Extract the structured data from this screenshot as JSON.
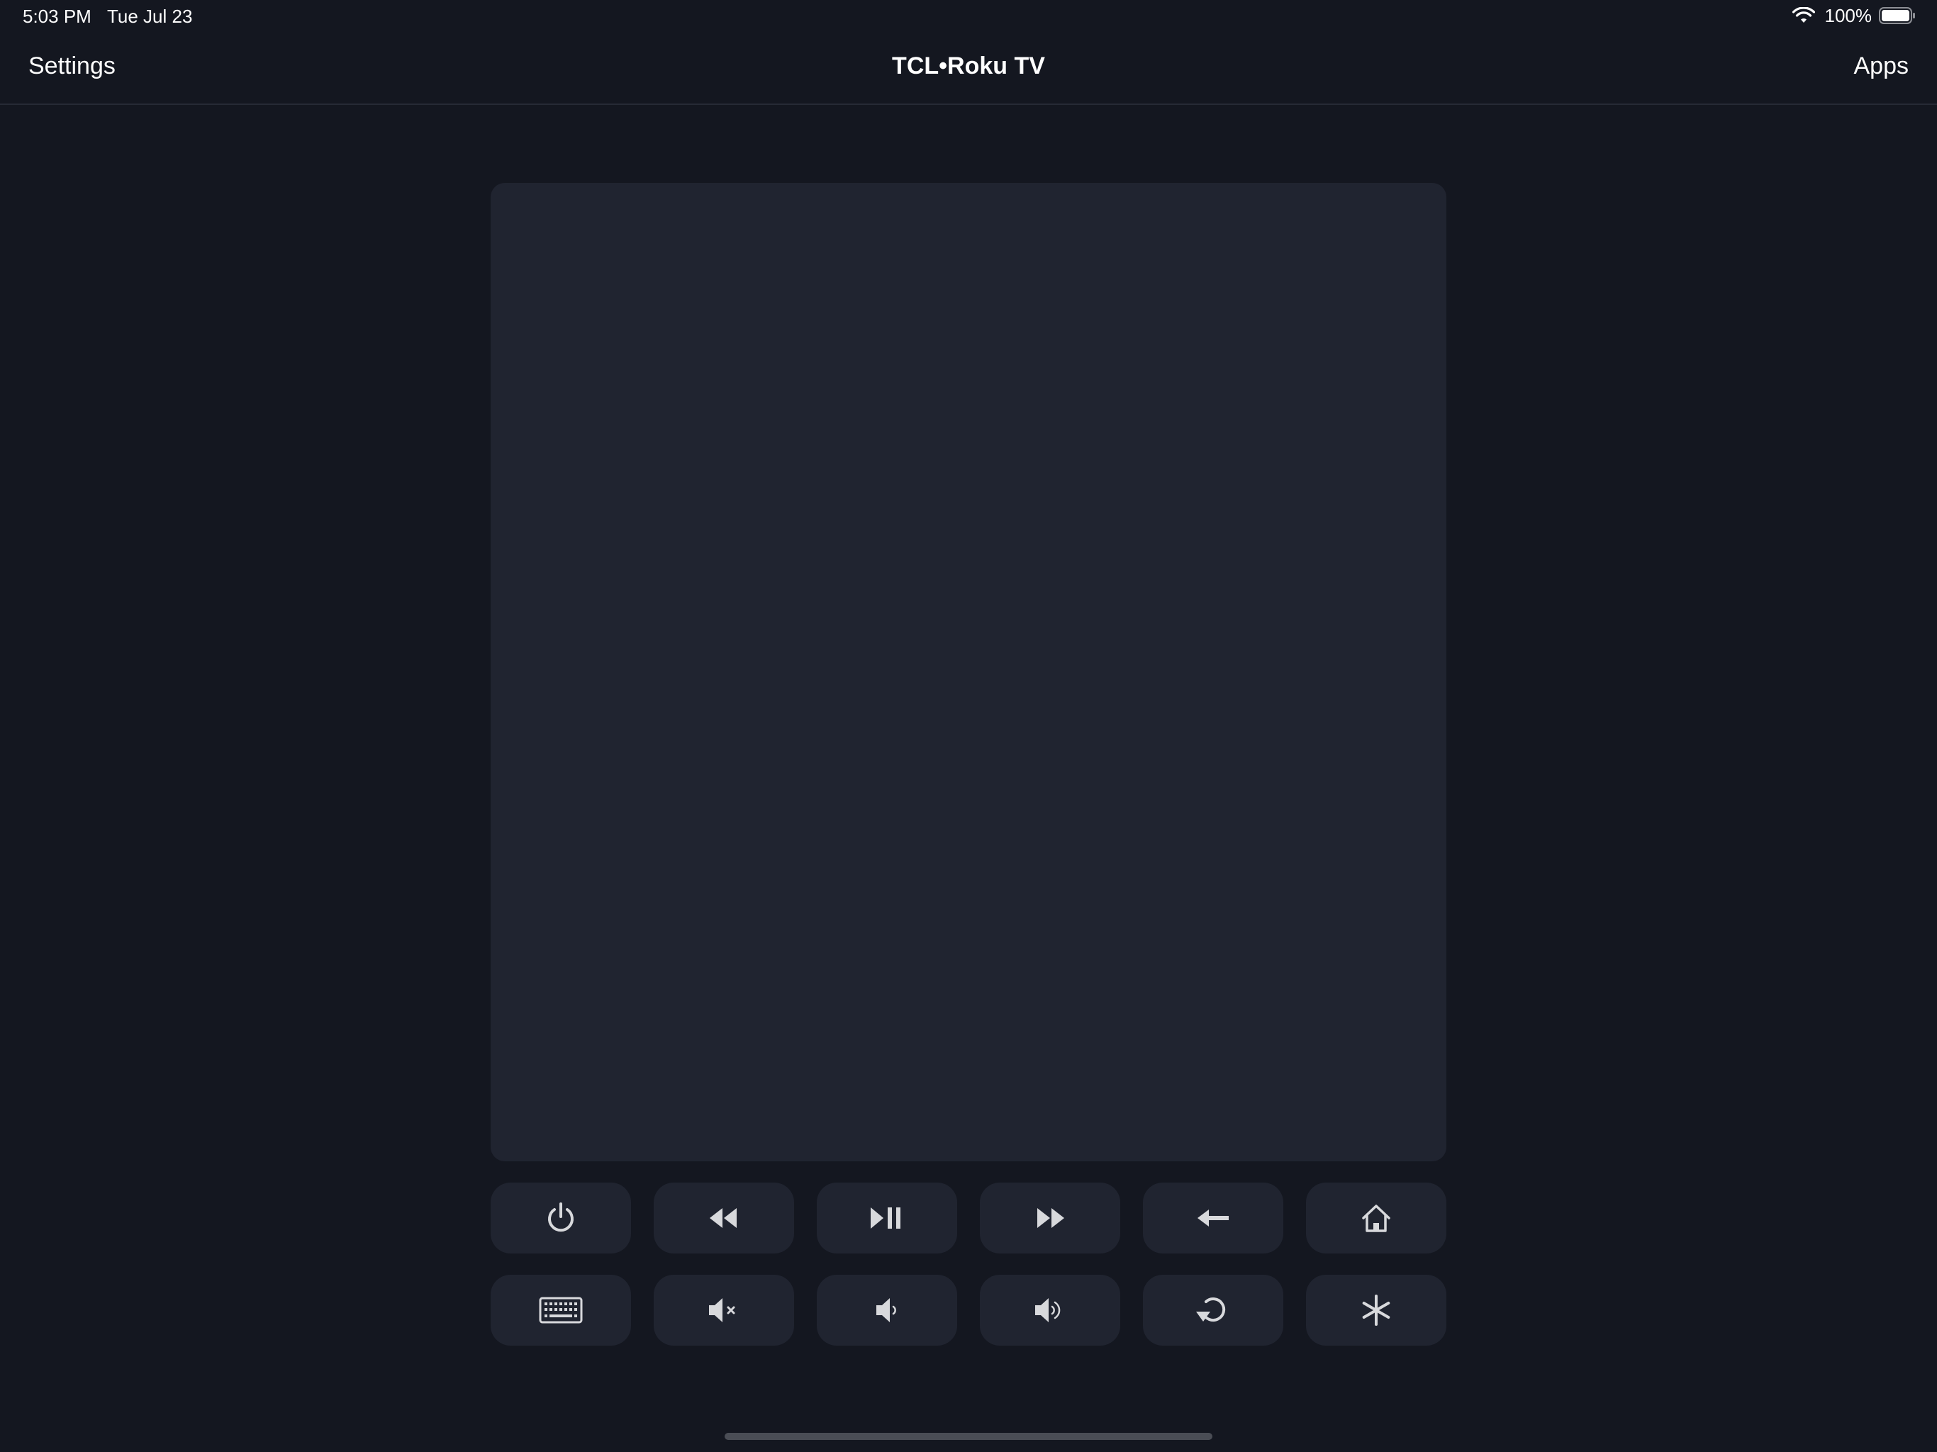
{
  "status_bar": {
    "time": "5:03 PM",
    "date": "Tue Jul 23",
    "battery_percent": "100%",
    "wifi_icon": "wifi-icon",
    "battery_icon": "battery-icon"
  },
  "nav": {
    "left_label": "Settings",
    "title": "TCL•Roku TV",
    "right_label": "Apps"
  },
  "touchpad": {
    "name": "touchpad"
  },
  "controls": {
    "row1": [
      {
        "icon": "power-icon"
      },
      {
        "icon": "rewind-icon"
      },
      {
        "icon": "play-pause-icon"
      },
      {
        "icon": "fast-forward-icon"
      },
      {
        "icon": "back-arrow-icon"
      },
      {
        "icon": "home-icon"
      }
    ],
    "row2": [
      {
        "icon": "keyboard-icon"
      },
      {
        "icon": "mute-icon"
      },
      {
        "icon": "volume-down-icon"
      },
      {
        "icon": "volume-up-icon"
      },
      {
        "icon": "replay-icon"
      },
      {
        "icon": "options-asterisk-icon"
      }
    ]
  },
  "colors": {
    "background": "#141720",
    "surface": "#202430",
    "icon": "#d8d9dc",
    "text": "#ffffff"
  }
}
